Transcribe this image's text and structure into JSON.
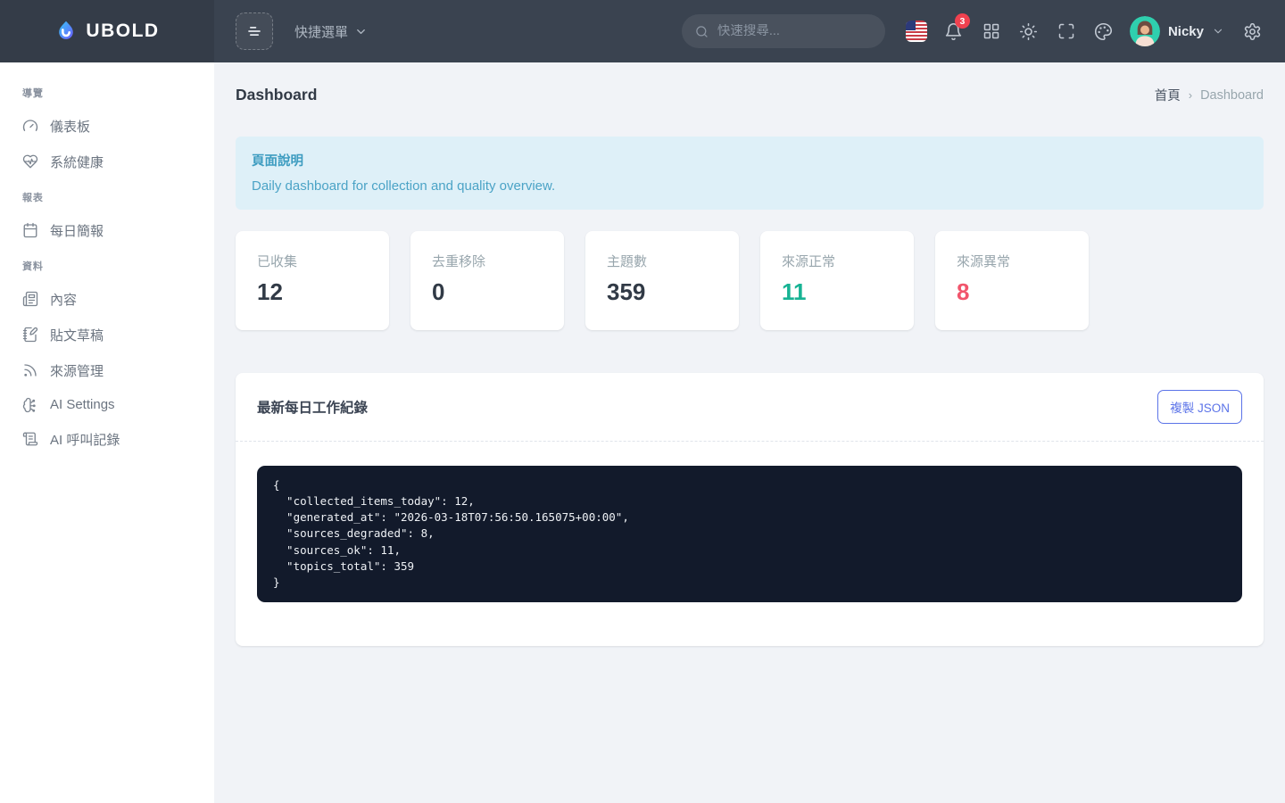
{
  "topbar": {
    "brand": "UBOLD",
    "quick_menu_label": "快捷選單",
    "search_placeholder": "快速搜尋...",
    "notification_count": "3",
    "user_name": "Nicky"
  },
  "sidebar": {
    "section_nav": "導覽",
    "section_reports": "報表",
    "section_data": "資料",
    "items": [
      {
        "label": "儀表板"
      },
      {
        "label": "系統健康"
      },
      {
        "label": "每日簡報"
      },
      {
        "label": "內容"
      },
      {
        "label": "貼文草稿"
      },
      {
        "label": "來源管理"
      },
      {
        "label": "AI Settings"
      },
      {
        "label": "AI 呼叫記錄"
      }
    ]
  },
  "page": {
    "title": "Dashboard",
    "breadcrumb": {
      "home": "首頁",
      "separator": "›",
      "current": "Dashboard"
    }
  },
  "alert": {
    "heading": "頁面說明",
    "message": "Daily dashboard for collection and quality overview."
  },
  "stats": [
    {
      "label": "已收集",
      "value": "12"
    },
    {
      "label": "去重移除",
      "value": "0"
    },
    {
      "label": "主題數",
      "value": "359"
    },
    {
      "label": "來源正常",
      "value": "11"
    },
    {
      "label": "來源異常",
      "value": "8"
    }
  ],
  "work_log": {
    "title": "最新每日工作紀錄",
    "copy_button_label": "複製 JSON",
    "json": "{\n  \"collected_items_today\": 12,\n  \"generated_at\": \"2026-03-18T07:56:50.165075+00:00\",\n  \"sources_degraded\": 8,\n  \"sources_ok\": 11,\n  \"topics_total\": 359\n}"
  },
  "colors": {
    "topbar_bg": "#3a4350",
    "brand_bg": "#343c48",
    "primary": "#5b73e8",
    "success": "#17b394",
    "danger": "#f1556c",
    "badge_red": "#f0414f",
    "alert_bg": "#def0f8",
    "alert_text": "#3d9cc0",
    "code_bg": "#121a2b",
    "page_bg": "#f1f3f7"
  }
}
